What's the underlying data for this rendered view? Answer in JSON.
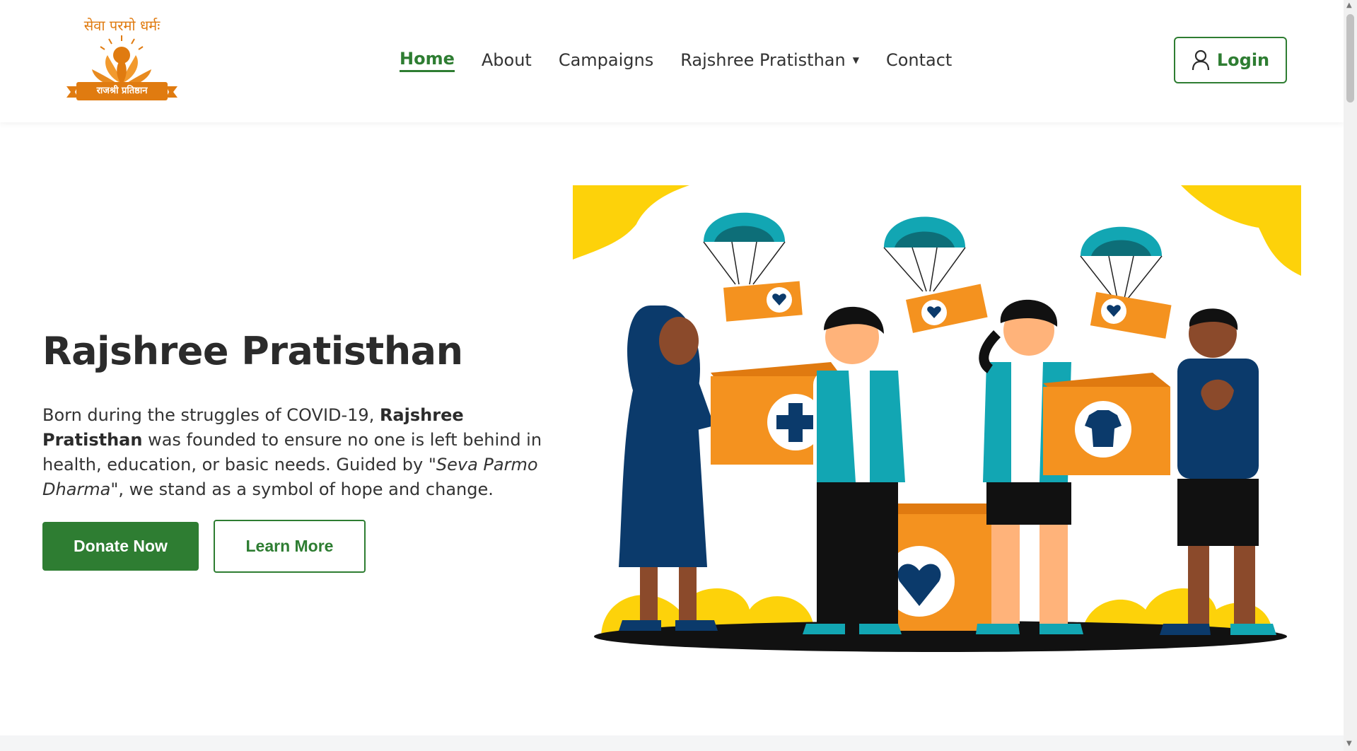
{
  "logo": {
    "motto": "सेवा परमो धर्मः",
    "banner": "राजश्री प्रतिष्ठान"
  },
  "nav": {
    "items": [
      {
        "label": "Home",
        "active": true
      },
      {
        "label": "About"
      },
      {
        "label": "Campaigns"
      },
      {
        "label": "Rajshree Pratisthan",
        "dropdown": true
      },
      {
        "label": "Contact"
      }
    ],
    "login_label": "Login"
  },
  "hero": {
    "title": "Rajshree Pratisthan",
    "text_1": "Born during the struggles of COVID-19, ",
    "text_bold": "Rajshree Pratisthan",
    "text_2": " was founded to ensure no one is left behind in health, education, or basic needs. Guided by ",
    "text_italic": "\"Seva Parmo Dharma\"",
    "text_3": ", we stand as a symbol of hope and change.",
    "donate_label": "Donate Now",
    "learn_label": "Learn More"
  },
  "colors": {
    "primary_green": "#2e7d32",
    "orange": "#f4921f",
    "yellow": "#fdd20a",
    "navy": "#0b3a6b",
    "teal": "#12a6b3"
  },
  "icons": {
    "login": "user-icon",
    "dropdown": "caret-down-icon"
  }
}
